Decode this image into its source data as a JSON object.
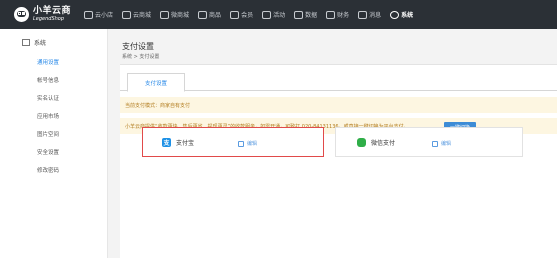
{
  "brand": {
    "name_cn": "小羊云商",
    "name_en": "LegendShop"
  },
  "nav": {
    "items": [
      {
        "label": "云小店",
        "icon": "store-icon"
      },
      {
        "label": "云商城",
        "icon": "cart-icon"
      },
      {
        "label": "微商城",
        "icon": "home-icon"
      },
      {
        "label": "商品",
        "icon": "mail-icon"
      },
      {
        "label": "会员",
        "icon": "user-icon"
      },
      {
        "label": "活动",
        "icon": "chat-icon"
      },
      {
        "label": "数据",
        "icon": "chart-icon"
      },
      {
        "label": "财务",
        "icon": "person-icon"
      },
      {
        "label": "消息",
        "icon": "message-icon"
      },
      {
        "label": "系统",
        "icon": "gear-icon"
      }
    ],
    "active_index": 9
  },
  "sidebar": {
    "header": "系统",
    "items": [
      {
        "label": "通用设置",
        "active": true
      },
      {
        "label": "帐号信息",
        "active": false
      },
      {
        "label": "实名认证",
        "active": false
      },
      {
        "label": "应用市场",
        "active": false
      },
      {
        "label": "图片空间",
        "active": false
      },
      {
        "label": "安全设置",
        "active": false
      },
      {
        "label": "修改密码",
        "active": false
      }
    ]
  },
  "page": {
    "title": "支付设置",
    "breadcrumb": "系统 > 支付设置",
    "tab": "支付设置",
    "notice_mode": "当前支付模式：商家自有支付",
    "notice_platform": "小羊云商提供“收款更快、售后更省、提现更灵”的收款服务，如需开通，可致打 020-84131136。或直接一键切换为平台支付。",
    "switch_button": "一键切换"
  },
  "payments": [
    {
      "name": "支付宝",
      "edit_label": "编辑",
      "selected": true
    },
    {
      "name": "微信支付",
      "edit_label": "编辑",
      "selected": false
    }
  ],
  "colors": {
    "topbar": "#2b3036",
    "accent": "#2a8ae8",
    "selected_border": "#e14a4a",
    "notice_bg": "#fdf6e1"
  }
}
